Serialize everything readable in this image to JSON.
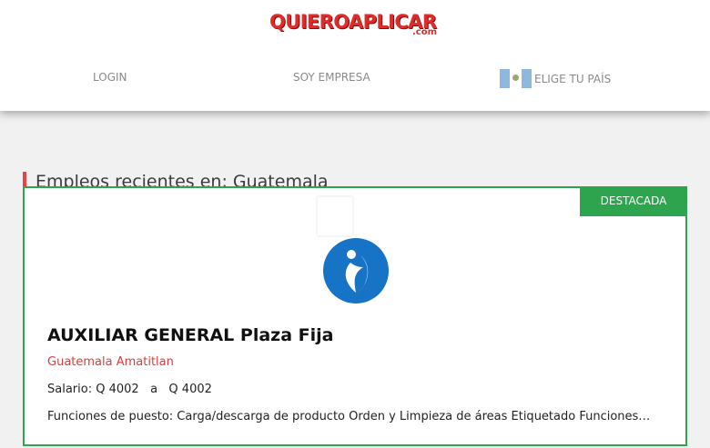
{
  "header": {
    "logo_main": "QUIEROAPLICAR",
    "logo_sub": ".com",
    "nav": {
      "login": "LOGIN",
      "empresa": "SOY EMPRESA",
      "pais": "ELIGE TU PAÍS"
    },
    "flag_icon": "guatemala-flag-icon"
  },
  "section": {
    "title": "Empleos recientes en: Guatemala"
  },
  "job": {
    "badge": "DESTACADA",
    "company_logo_icon": "company-logo-icon",
    "title": "AUXILIAR GENERAL Plaza Fija",
    "location": "Guatemala Amatitlan",
    "salary": "Salario: Q 4002   a   Q 4002",
    "description": "Funciones de puesto: Carga/descarga de producto Orden y Limpieza de áreas Etiquetado Funciones adicionales"
  },
  "colors": {
    "brand_red": "#e02b2b",
    "accent_green": "#2ea44f",
    "logo_blue": "#1673c6"
  }
}
